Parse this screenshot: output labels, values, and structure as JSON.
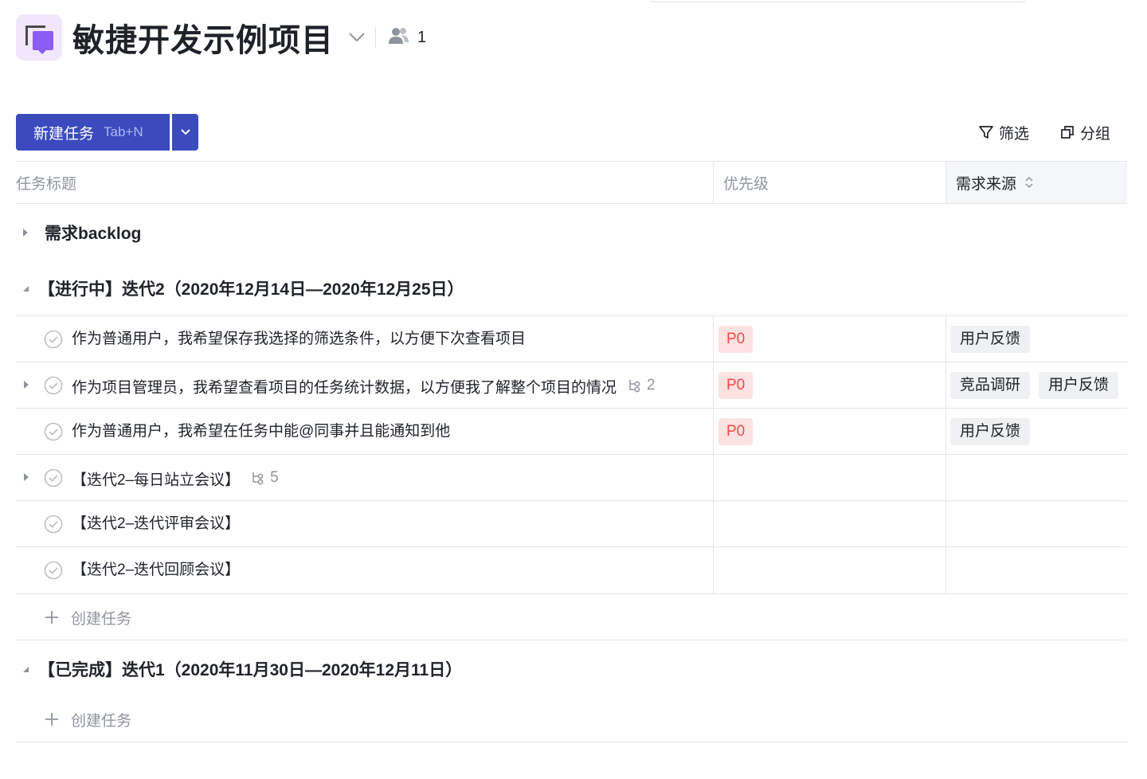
{
  "project": {
    "title": "敏捷开发示例项目",
    "member_count": "1"
  },
  "toolbar": {
    "new_task_label": "新建任务",
    "new_task_shortcut": "Tab+N",
    "filter_label": "筛选",
    "group_label": "分组"
  },
  "columns": {
    "title": "任务标题",
    "priority": "优先级",
    "source": "需求来源"
  },
  "groups": [
    {
      "title": "需求backlog",
      "expanded": false
    },
    {
      "title": "【进行中】迭代2（2020年12月14日—2020年12月25日）",
      "expanded": true
    },
    {
      "title": "【已完成】迭代1（2020年11月30日—2020年12月11日）",
      "expanded": true
    }
  ],
  "tasks": [
    {
      "title": "作为普通用户，我希望保存我选择的筛选条件，以方便下次查看项目",
      "priority": "P0",
      "tags": [
        "用户反馈"
      ]
    },
    {
      "title": "作为项目管理员，我希望查看项目的任务统计数据，以方便我了解整个项目的情况",
      "subtasks": "2",
      "priority": "P0",
      "tags": [
        "竞品调研",
        "用户反馈"
      ]
    },
    {
      "title": "作为普通用户，我希望在任务中能@同事并且能通知到他",
      "priority": "P0",
      "tags": [
        "用户反馈"
      ]
    },
    {
      "title": "【迭代2–每日站立会议】",
      "subtasks": "5"
    },
    {
      "title": "【迭代2–迭代评审会议】"
    },
    {
      "title": "【迭代2–迭代回顾会议】"
    }
  ],
  "create_task_label": "创建任务",
  "colors": {
    "primary": "#3b4bbd",
    "priority_bg": "#fde2e2",
    "priority_text": "#f54a45",
    "tag_bg": "#eff0f1"
  }
}
